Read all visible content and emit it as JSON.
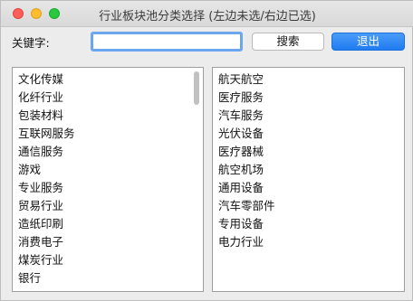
{
  "window": {
    "title": "行业板块池分类选择 (左边未选/右边已选)"
  },
  "search": {
    "label": "关键字:",
    "value": "",
    "placeholder": ""
  },
  "buttons": {
    "search_label": "搜索",
    "exit_label": "退出"
  },
  "colors": {
    "accent": "#1f7bf0",
    "focus_ring": "#6aa7ef"
  },
  "unselected": {
    "items": [
      "文化传媒",
      "化纤行业",
      "包装材料",
      "互联网服务",
      "通信服务",
      "游戏",
      "专业服务",
      "贸易行业",
      "造纸印刷",
      "消费电子",
      "煤炭行业",
      "银行"
    ]
  },
  "selected": {
    "items": [
      "航天航空",
      "医疗服务",
      "汽车服务",
      "光伏设备",
      "医疗器械",
      "航空机场",
      "通用设备",
      "汽车零部件",
      "专用设备",
      "电力行业"
    ]
  }
}
